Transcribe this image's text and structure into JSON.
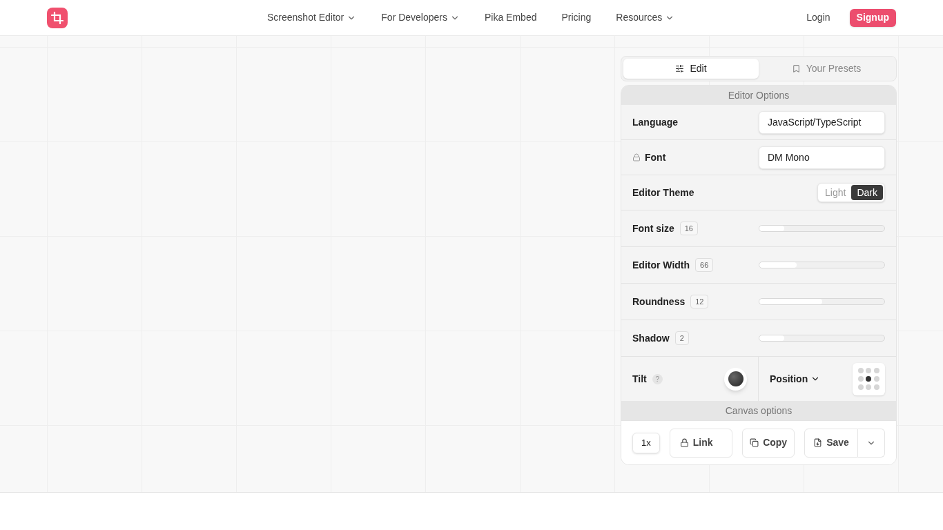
{
  "nav": {
    "links": [
      {
        "label": "Screenshot Editor",
        "dropdown": true
      },
      {
        "label": "For Developers",
        "dropdown": true
      },
      {
        "label": "Pika Embed",
        "dropdown": false
      },
      {
        "label": "Pricing",
        "dropdown": false
      },
      {
        "label": "Resources",
        "dropdown": true
      }
    ],
    "login": "Login",
    "signup": "Signup"
  },
  "tabs": [
    {
      "label": "Edit",
      "selected": true
    },
    {
      "label": "Your Presets",
      "selected": false
    }
  ],
  "editor_options": {
    "title": "Editor Options",
    "language": {
      "label": "Language",
      "value": "JavaScript/TypeScript"
    },
    "font": {
      "label": "Font",
      "locked": true,
      "value": "DM Mono"
    },
    "theme": {
      "label": "Editor Theme",
      "options": [
        {
          "label": "Light",
          "selected": false
        },
        {
          "label": "Dark",
          "selected": true
        }
      ]
    },
    "sliders": [
      {
        "label": "Font size",
        "reading": "16",
        "level": 0.2
      },
      {
        "label": "Editor Width",
        "reading": "66",
        "level": 0.3
      },
      {
        "label": "Roundness",
        "reading": "12",
        "level": 0.5
      },
      {
        "label": "Shadow",
        "reading": "2",
        "level": 0.2
      }
    ],
    "tilt": {
      "label": "Tilt",
      "help": "?"
    },
    "position": {
      "label": "Position",
      "cells": [
        {
          "selected": false
        },
        {
          "selected": false
        },
        {
          "selected": false
        },
        {
          "selected": false
        },
        {
          "selected": true
        },
        {
          "selected": false
        },
        {
          "selected": false
        },
        {
          "selected": false
        },
        {
          "selected": false
        }
      ]
    }
  },
  "canvas_options": {
    "title": "Canvas options"
  },
  "actions": {
    "scale": "1x",
    "link": "Link",
    "copy": "Copy",
    "save": "Save"
  }
}
